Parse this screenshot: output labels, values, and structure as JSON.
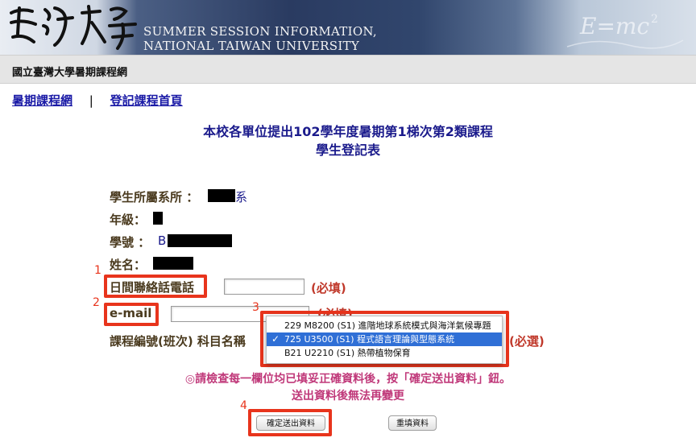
{
  "banner": {
    "logo_text": "臺灣大學",
    "title_en_line1": "SUMMER SESSION INFORMATION,",
    "title_en_line2": "NATIONAL TAIWAN UNIVERSITY",
    "formula_text": "E=mc²"
  },
  "site_bar": {
    "site_name": "國立臺灣大學暑期課程網"
  },
  "nav": {
    "link_home": "暑期課程網",
    "separator": "|",
    "link_register_home": "登記課程首頁"
  },
  "form_title": {
    "line1": "本校各單位提出102學年度暑期第1梯次第2類課程",
    "line2": "學生登記表"
  },
  "fields": {
    "department_label": "學生所屬系所 ：",
    "department_suffix": "系",
    "grade_label": "年級：",
    "student_id_label": "學號 ：",
    "student_id_prefix": "B",
    "name_label": "姓名：",
    "phone_label": "日間聯絡話電話",
    "phone_value": "",
    "phone_required": "(必填)",
    "email_label": "e-mail",
    "email_value": "",
    "email_required": "(必填)",
    "course_label": "課程編號(班次) 科目名稱",
    "course_required": "(必選)"
  },
  "course_dropdown": {
    "options": [
      "229 M8200 (S1) 進階地球系統模式與海洋氣候專題",
      "725 U3500 (S1) 程式語言理論與型態系統",
      "B21 U2210 (S1) 熱帶植物保育"
    ],
    "selected_index": 1,
    "check_mark": "✓"
  },
  "notice": {
    "line1": "◎請檢查每一欄位均已填妥正確資料後，按「確定送出資料」鈕。",
    "line2": "送出資料後無法再變更"
  },
  "buttons": {
    "submit_label": "確定送出資料",
    "reset_label": "重填資料"
  },
  "annotations": {
    "n1": "1",
    "n2": "2",
    "n3": "3",
    "n4": "4",
    "color": "#e8341c"
  }
}
